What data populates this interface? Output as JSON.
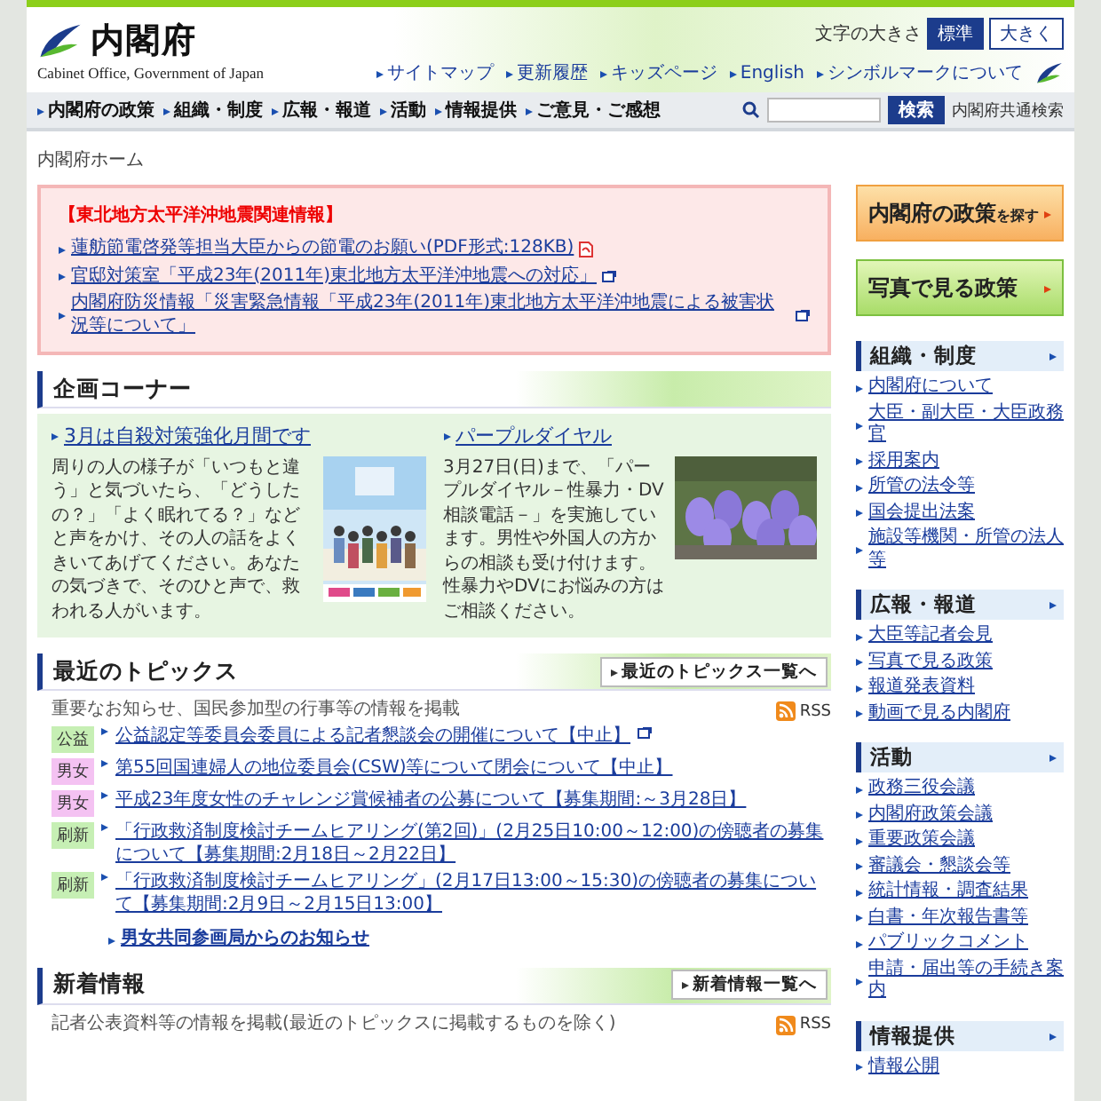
{
  "header": {
    "logo_title": "内閣府",
    "logo_subtitle": "Cabinet Office, Government of Japan",
    "font_size_label": "文字の大きさ",
    "font_size_buttons": [
      {
        "label": "標準",
        "selected": true
      },
      {
        "label": "大きく",
        "selected": false
      }
    ],
    "utility_links": [
      "サイトマップ",
      "更新履歴",
      "キッズページ",
      "English",
      "シンボルマークについて"
    ],
    "nav": [
      "内閣府の政策",
      "組織・制度",
      "広報・報道",
      "活動",
      "情報提供",
      "ご意見・ご感想"
    ],
    "search": {
      "button": "検索",
      "note": "内閣府共通検索"
    }
  },
  "breadcrumb": "内閣府ホーム",
  "alert": {
    "title": "【東北地方太平洋沖地震関連情報】",
    "links": [
      {
        "text": "蓮舫節電啓発等担当大臣からの節電のお願い(PDF形式:128KB)",
        "kind": "pdf"
      },
      {
        "text": "官邸対策室「平成23年(2011年)東北地方太平洋沖地震への対応」",
        "kind": "external"
      },
      {
        "text": "内閣府防災情報「災害緊急情報「平成23年(2011年)東北地方太平洋沖地震による被害状況等について」",
        "kind": "external"
      }
    ]
  },
  "feature": {
    "title": "企画コーナー",
    "items": [
      {
        "title": "3月は自殺対策強化月間です",
        "text": "周りの人の様子が「いつもと違う」と気づいたら、「どうしたの？」「よく眠れてる？」などと声をかけ、その人の話をよくきいてあげてください。あなたの気づきで、そのひと声で、救われる人がいます。"
      },
      {
        "title": "パープルダイヤル",
        "text": "3月27日(日)まで、「パープルダイヤル－性暴力・DV相談電話－」を実施しています。男性や外国人の方からの相談も受け付けます。性暴力やDVにお悩みの方はご相談ください。"
      }
    ]
  },
  "topics": {
    "title": "最近のトピックス",
    "more_link": "最近のトピックス一覧へ",
    "rss": "RSS",
    "description": "重要なお知らせ、国民参加型の行事等の情報を掲載",
    "items": [
      {
        "tag": "公益",
        "color": "#c6efb4",
        "text": "公益認定等委員会委員による記者懇談会の開催について【中止】",
        "external": true
      },
      {
        "tag": "男女",
        "color": "#f4c2f2",
        "text": "第55回国連婦人の地位委員会(CSW)等について閉会について【中止】",
        "external": false
      },
      {
        "tag": "男女",
        "color": "#f4c2f2",
        "text": "平成23年度女性のチャレンジ賞候補者の公募について【募集期間:～3月28日】",
        "external": false
      },
      {
        "tag": "刷新",
        "color": "#c6efb4",
        "text": "「行政救済制度検討チームヒアリング(第2回)」(2月25日10:00～12:00)の傍聴者の募集について【募集期間:2月18日～2月22日】",
        "external": false
      },
      {
        "tag": "刷新",
        "color": "#c6efb4",
        "text": "「行政救済制度検討チームヒアリング」(2月17日13:00～15:30)の傍聴者の募集について【募集期間:2月9日～2月15日13:00】",
        "external": false
      }
    ],
    "footer_link": "男女共同参画局からのお知らせ"
  },
  "news": {
    "title": "新着情報",
    "more_link": "新着情報一覧へ",
    "rss": "RSS",
    "description": "記者公表資料等の情報を掲載(最近のトピックスに掲載するものを除く)"
  },
  "sidebar": {
    "promos": [
      {
        "kind": "orange",
        "label": "内閣府の政策",
        "sub": "を探す"
      },
      {
        "kind": "green",
        "label": "写真で見る政策"
      }
    ],
    "sections": [
      {
        "title": "組織・制度",
        "links": [
          "内閣府について",
          "大臣・副大臣・大臣政務官",
          "採用案内",
          "所管の法令等",
          "国会提出法案",
          "施設等機関・所管の法人等"
        ]
      },
      {
        "title": "広報・報道",
        "links": [
          "大臣等記者会見",
          "写真で見る政策",
          "報道発表資料",
          "動画で見る内閣府"
        ]
      },
      {
        "title": "活動",
        "links": [
          "政務三役会議",
          "内閣府政策会議",
          "重要政策会議",
          "審議会・懇談会等",
          "統計情報・調査結果",
          "白書・年次報告書等",
          "パブリックコメント",
          "申請・届出等の手続き案内"
        ]
      },
      {
        "title": "情報提供",
        "links": [
          "情報公開"
        ]
      }
    ]
  }
}
